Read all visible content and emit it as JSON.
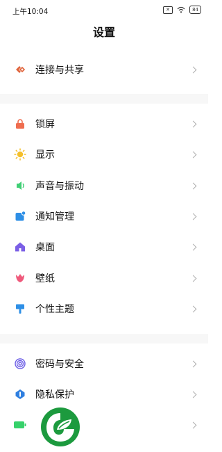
{
  "status_bar": {
    "time": "上午10:04",
    "battery": "84"
  },
  "header": {
    "title": "设置"
  },
  "sections": [
    {
      "items": [
        {
          "label": "连接与共享",
          "icon": "connect-share-icon",
          "color": "#e0643c"
        }
      ]
    },
    {
      "items": [
        {
          "label": "锁屏",
          "icon": "lock-screen-icon",
          "color": "#ef6d4f"
        },
        {
          "label": "显示",
          "icon": "sun-icon",
          "color": "#f4bf2a"
        },
        {
          "label": "声音与振动",
          "icon": "speaker-icon",
          "color": "#3fcf74"
        },
        {
          "label": "通知管理",
          "icon": "notification-icon",
          "color": "#2e8fe6"
        },
        {
          "label": "桌面",
          "icon": "home-icon",
          "color": "#7b5fe6"
        },
        {
          "label": "壁纸",
          "icon": "tulip-icon",
          "color": "#ef5a7c"
        },
        {
          "label": "个性主题",
          "icon": "brush-icon",
          "color": "#2e8fe6"
        }
      ]
    },
    {
      "items": [
        {
          "label": "密码与安全",
          "icon": "fingerprint-icon",
          "color": "#6d5fe6"
        },
        {
          "label": "隐私保护",
          "icon": "privacy-icon",
          "color": "#2f7fe0"
        },
        {
          "label": "",
          "icon": "battery-icon",
          "color": "#36d16a"
        }
      ]
    }
  ],
  "watermark": {
    "icon": "leaf-logo-icon",
    "color": "#1c9a3e"
  }
}
